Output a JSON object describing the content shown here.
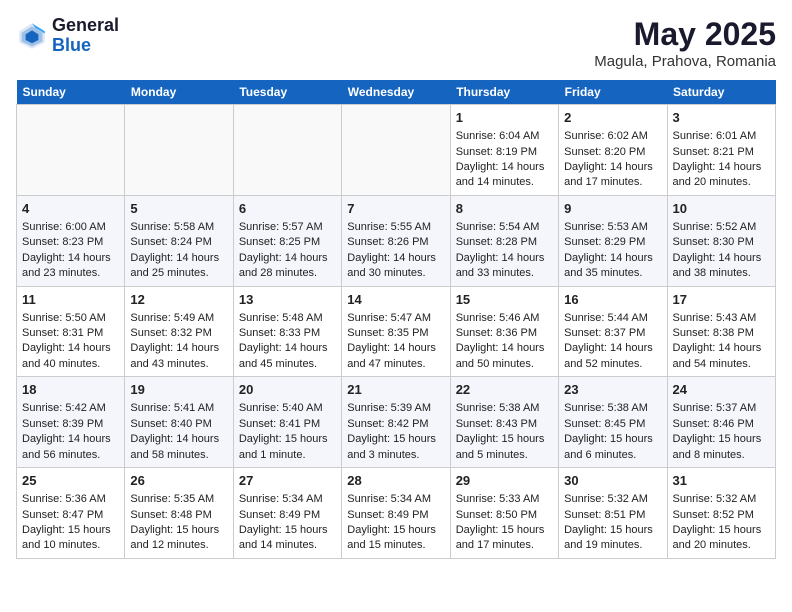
{
  "header": {
    "logo_line1": "General",
    "logo_line2": "Blue",
    "title": "May 2025",
    "subtitle": "Magula, Prahova, Romania"
  },
  "days_of_week": [
    "Sunday",
    "Monday",
    "Tuesday",
    "Wednesday",
    "Thursday",
    "Friday",
    "Saturday"
  ],
  "weeks": [
    [
      {
        "day": "",
        "info": ""
      },
      {
        "day": "",
        "info": ""
      },
      {
        "day": "",
        "info": ""
      },
      {
        "day": "",
        "info": ""
      },
      {
        "day": "1",
        "info": "Sunrise: 6:04 AM\nSunset: 8:19 PM\nDaylight: 14 hours\nand 14 minutes."
      },
      {
        "day": "2",
        "info": "Sunrise: 6:02 AM\nSunset: 8:20 PM\nDaylight: 14 hours\nand 17 minutes."
      },
      {
        "day": "3",
        "info": "Sunrise: 6:01 AM\nSunset: 8:21 PM\nDaylight: 14 hours\nand 20 minutes."
      }
    ],
    [
      {
        "day": "4",
        "info": "Sunrise: 6:00 AM\nSunset: 8:23 PM\nDaylight: 14 hours\nand 23 minutes."
      },
      {
        "day": "5",
        "info": "Sunrise: 5:58 AM\nSunset: 8:24 PM\nDaylight: 14 hours\nand 25 minutes."
      },
      {
        "day": "6",
        "info": "Sunrise: 5:57 AM\nSunset: 8:25 PM\nDaylight: 14 hours\nand 28 minutes."
      },
      {
        "day": "7",
        "info": "Sunrise: 5:55 AM\nSunset: 8:26 PM\nDaylight: 14 hours\nand 30 minutes."
      },
      {
        "day": "8",
        "info": "Sunrise: 5:54 AM\nSunset: 8:28 PM\nDaylight: 14 hours\nand 33 minutes."
      },
      {
        "day": "9",
        "info": "Sunrise: 5:53 AM\nSunset: 8:29 PM\nDaylight: 14 hours\nand 35 minutes."
      },
      {
        "day": "10",
        "info": "Sunrise: 5:52 AM\nSunset: 8:30 PM\nDaylight: 14 hours\nand 38 minutes."
      }
    ],
    [
      {
        "day": "11",
        "info": "Sunrise: 5:50 AM\nSunset: 8:31 PM\nDaylight: 14 hours\nand 40 minutes."
      },
      {
        "day": "12",
        "info": "Sunrise: 5:49 AM\nSunset: 8:32 PM\nDaylight: 14 hours\nand 43 minutes."
      },
      {
        "day": "13",
        "info": "Sunrise: 5:48 AM\nSunset: 8:33 PM\nDaylight: 14 hours\nand 45 minutes."
      },
      {
        "day": "14",
        "info": "Sunrise: 5:47 AM\nSunset: 8:35 PM\nDaylight: 14 hours\nand 47 minutes."
      },
      {
        "day": "15",
        "info": "Sunrise: 5:46 AM\nSunset: 8:36 PM\nDaylight: 14 hours\nand 50 minutes."
      },
      {
        "day": "16",
        "info": "Sunrise: 5:44 AM\nSunset: 8:37 PM\nDaylight: 14 hours\nand 52 minutes."
      },
      {
        "day": "17",
        "info": "Sunrise: 5:43 AM\nSunset: 8:38 PM\nDaylight: 14 hours\nand 54 minutes."
      }
    ],
    [
      {
        "day": "18",
        "info": "Sunrise: 5:42 AM\nSunset: 8:39 PM\nDaylight: 14 hours\nand 56 minutes."
      },
      {
        "day": "19",
        "info": "Sunrise: 5:41 AM\nSunset: 8:40 PM\nDaylight: 14 hours\nand 58 minutes."
      },
      {
        "day": "20",
        "info": "Sunrise: 5:40 AM\nSunset: 8:41 PM\nDaylight: 15 hours\nand 1 minute."
      },
      {
        "day": "21",
        "info": "Sunrise: 5:39 AM\nSunset: 8:42 PM\nDaylight: 15 hours\nand 3 minutes."
      },
      {
        "day": "22",
        "info": "Sunrise: 5:38 AM\nSunset: 8:43 PM\nDaylight: 15 hours\nand 5 minutes."
      },
      {
        "day": "23",
        "info": "Sunrise: 5:38 AM\nSunset: 8:45 PM\nDaylight: 15 hours\nand 6 minutes."
      },
      {
        "day": "24",
        "info": "Sunrise: 5:37 AM\nSunset: 8:46 PM\nDaylight: 15 hours\nand 8 minutes."
      }
    ],
    [
      {
        "day": "25",
        "info": "Sunrise: 5:36 AM\nSunset: 8:47 PM\nDaylight: 15 hours\nand 10 minutes."
      },
      {
        "day": "26",
        "info": "Sunrise: 5:35 AM\nSunset: 8:48 PM\nDaylight: 15 hours\nand 12 minutes."
      },
      {
        "day": "27",
        "info": "Sunrise: 5:34 AM\nSunset: 8:49 PM\nDaylight: 15 hours\nand 14 minutes."
      },
      {
        "day": "28",
        "info": "Sunrise: 5:34 AM\nSunset: 8:49 PM\nDaylight: 15 hours\nand 15 minutes."
      },
      {
        "day": "29",
        "info": "Sunrise: 5:33 AM\nSunset: 8:50 PM\nDaylight: 15 hours\nand 17 minutes."
      },
      {
        "day": "30",
        "info": "Sunrise: 5:32 AM\nSunset: 8:51 PM\nDaylight: 15 hours\nand 19 minutes."
      },
      {
        "day": "31",
        "info": "Sunrise: 5:32 AM\nSunset: 8:52 PM\nDaylight: 15 hours\nand 20 minutes."
      }
    ]
  ]
}
